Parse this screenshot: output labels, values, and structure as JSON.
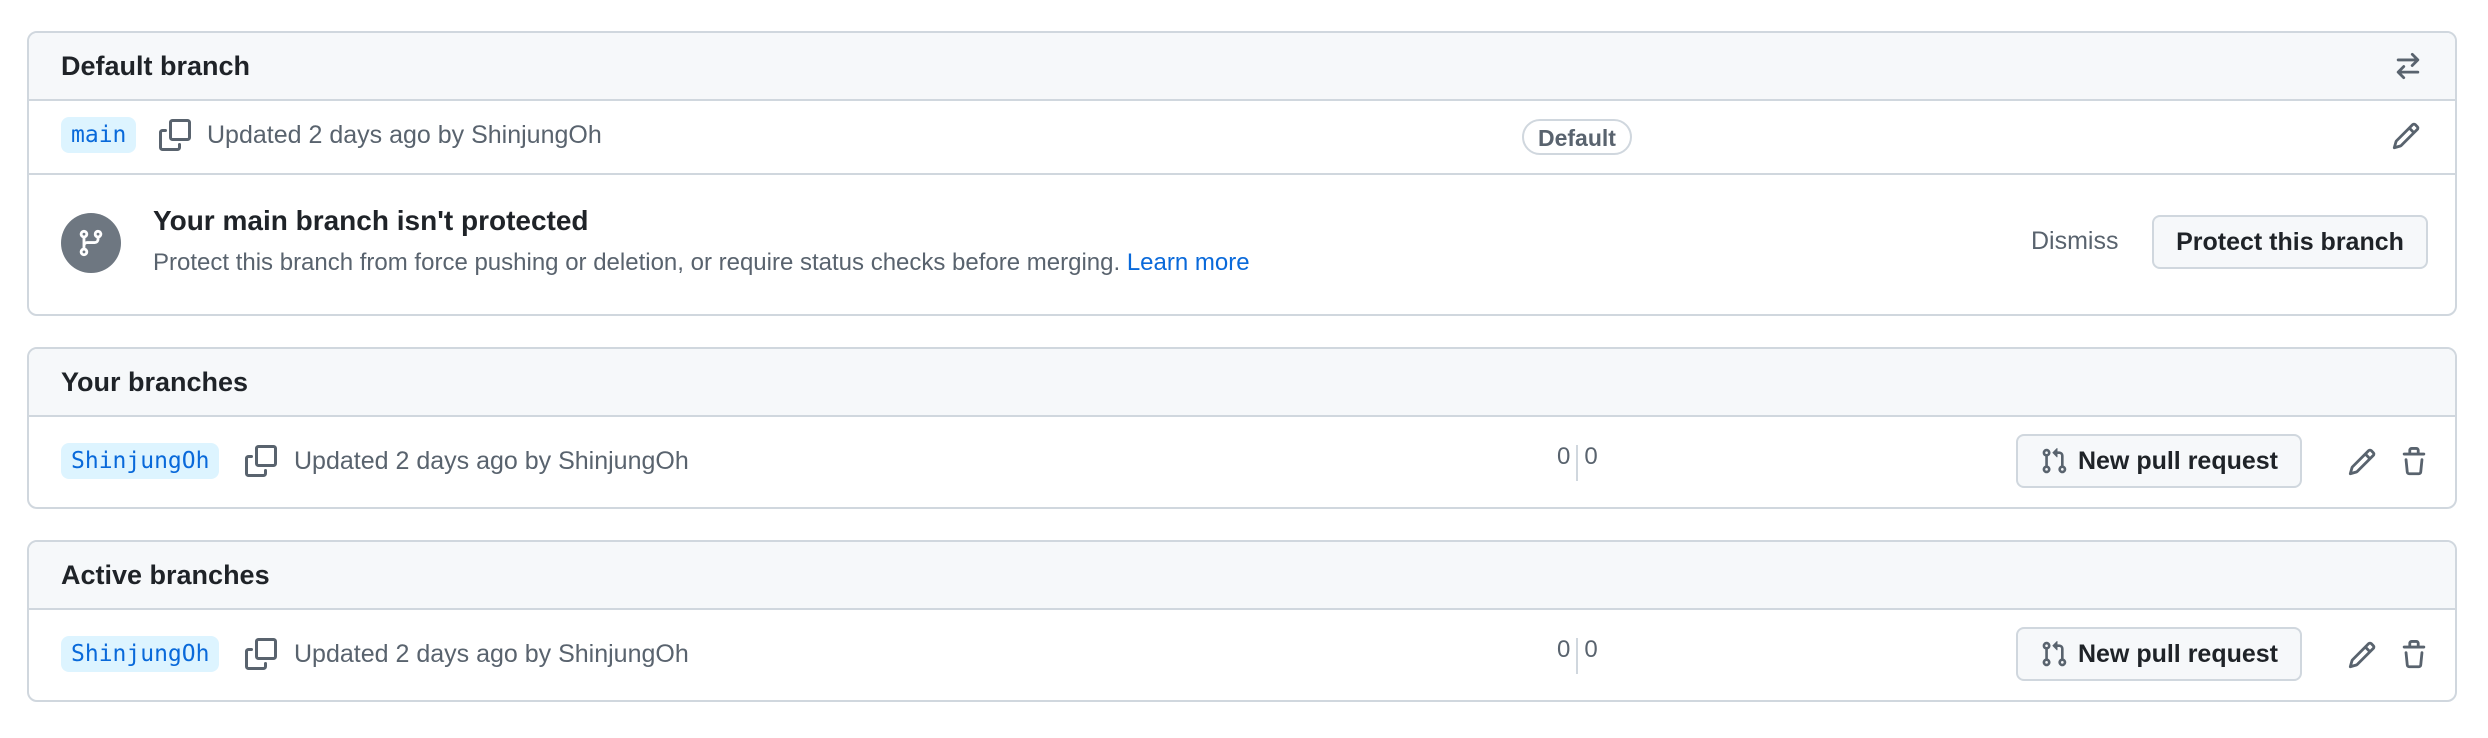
{
  "default_branch": {
    "title": "Default branch",
    "switch_icon": "arrow-switch-icon",
    "branch": {
      "name": "main",
      "updated": "Updated 2 days ago by ShinjungOh",
      "badge": "Default"
    },
    "warning": {
      "title": "Your main branch isn't protected",
      "description": "Protect this branch from force pushing or deletion, or require status checks before merging.",
      "link": "Learn more",
      "dismiss": "Dismiss",
      "protect_button": "Protect this branch"
    }
  },
  "your_branches": {
    "title": "Your branches",
    "branch": {
      "name": "ShinjungOh",
      "updated": "Updated 2 days ago by ShinjungOh",
      "behind": "0",
      "ahead": "0",
      "pr_button": "New pull request"
    }
  },
  "active_branches": {
    "title": "Active branches",
    "branch": {
      "name": "ShinjungOh",
      "updated": "Updated 2 days ago by ShinjungOh",
      "behind": "0",
      "ahead": "0",
      "pr_button": "New pull request"
    }
  },
  "colors": {
    "accent": "#0969da",
    "branch_bg": "#ddf4ff",
    "border": "#d0d7de",
    "header_bg": "#f6f8fa",
    "muted": "#59636e"
  }
}
